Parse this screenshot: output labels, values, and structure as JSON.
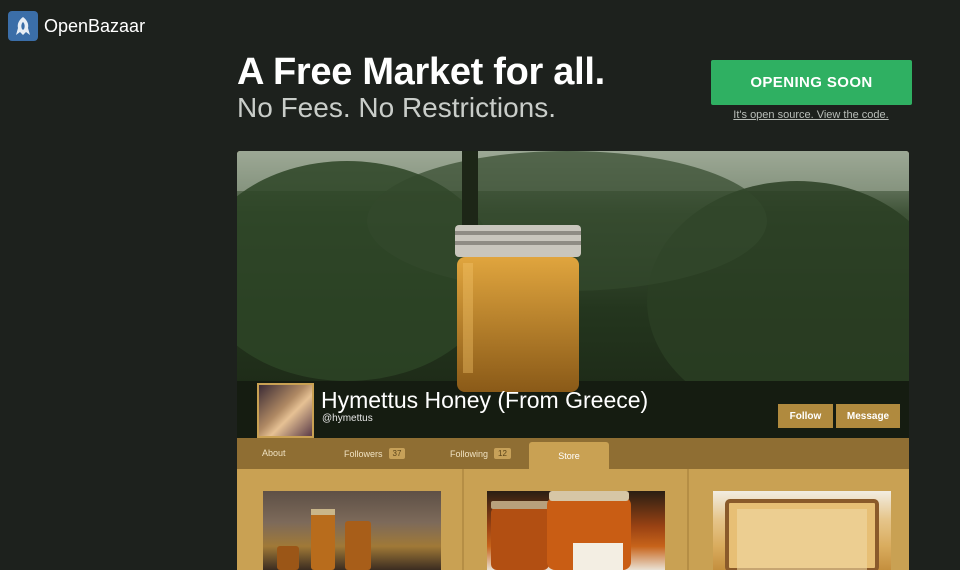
{
  "brand": {
    "name": "OpenBazaar"
  },
  "hero": {
    "title": "A Free Market for all.",
    "subtitle": "No Fees. No Restrictions.",
    "cta_label": "OPENING SOON",
    "code_link": "It's open source. View the code."
  },
  "store": {
    "name": "Hymettus Honey (From Greece)",
    "handle": "@hymettus",
    "follow_label": "Follow",
    "message_label": "Message"
  },
  "tabs": [
    {
      "label": "About"
    },
    {
      "label": "Followers",
      "count": "37"
    },
    {
      "label": "Following",
      "count": "12"
    },
    {
      "label": "Store"
    }
  ],
  "colors": {
    "background": "#1d211d",
    "cta": "#2fb062",
    "store_gold": "#c9a153",
    "tabbar": "#8f6e33",
    "button": "#b08a3e"
  },
  "icons": {
    "logo": "openbazaar-logo-icon"
  }
}
